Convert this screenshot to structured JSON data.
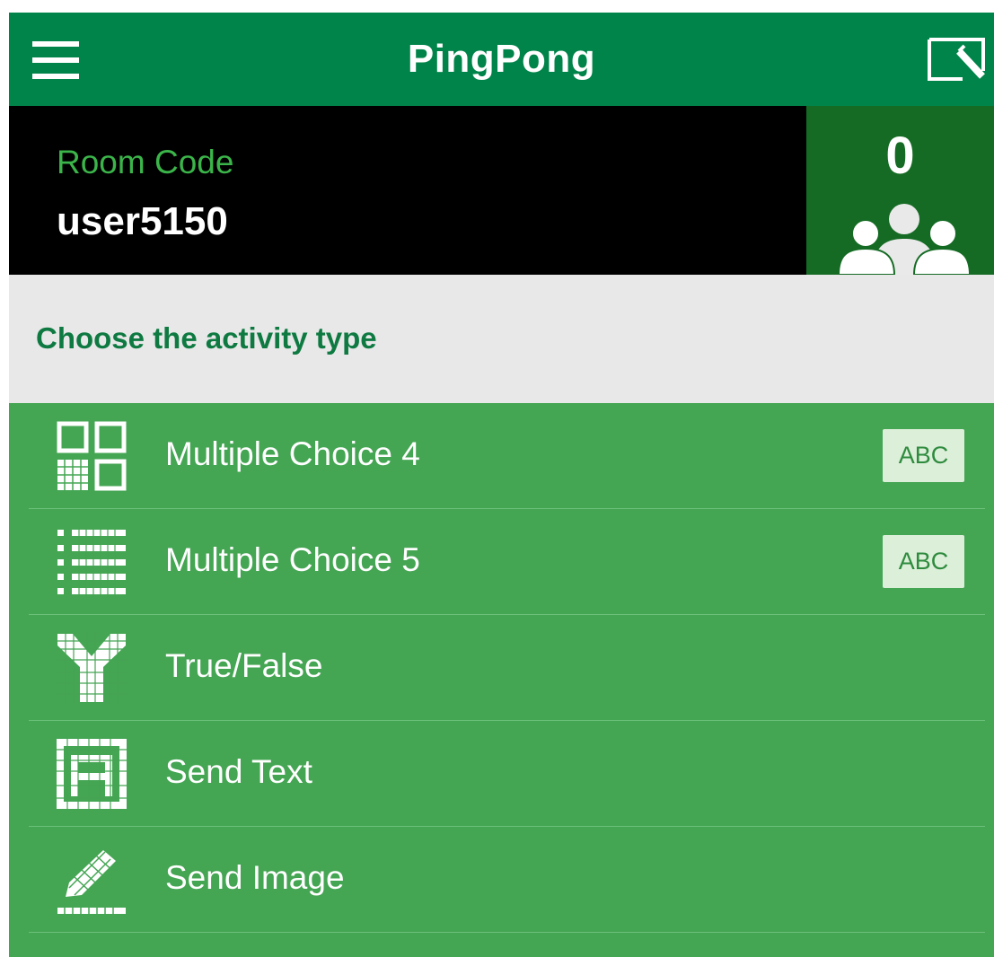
{
  "app": {
    "title": "PingPong"
  },
  "header": {
    "menu_icon": "hamburger-menu-icon",
    "screen_icon": "screen-edit-icon"
  },
  "room": {
    "label": "Room Code",
    "code": "user5150",
    "participant_count": "0",
    "participants_icon": "group-icon"
  },
  "section": {
    "heading": "Choose the activity type"
  },
  "activities": [
    {
      "label": "Multiple Choice 4",
      "icon": "grid-four-icon",
      "badge": "ABC"
    },
    {
      "label": "Multiple Choice 5",
      "icon": "list-five-icon",
      "badge": "ABC"
    },
    {
      "label": "True/False",
      "icon": "y-fork-icon"
    },
    {
      "label": "Send Text",
      "icon": "letter-a-icon"
    },
    {
      "label": "Send Image",
      "icon": "pencil-icon"
    }
  ],
  "colors": {
    "header": "#00844a",
    "room_bg": "#000000",
    "room_label": "#3bb54a",
    "count_bg": "#156b24",
    "section_bg": "#e8e8e8",
    "heading": "#0e7a42",
    "list_bg": "#44a553",
    "badge_bg": "#dcefd9",
    "badge_text": "#2e8b3e"
  }
}
